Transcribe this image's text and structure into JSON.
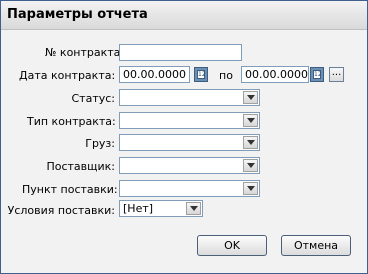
{
  "window": {
    "title": "Параметры отчета"
  },
  "form": {
    "contract_number": {
      "label": "№ контракта:",
      "value": ""
    },
    "contract_date": {
      "label": "Дата контракта:",
      "from": "00.00.0000",
      "separator": "по",
      "to": "00.00.0000",
      "more_button": "..."
    },
    "status": {
      "label": "Статус:",
      "value": ""
    },
    "contract_type": {
      "label": "Тип контракта:",
      "value": ""
    },
    "cargo": {
      "label": "Груз:",
      "value": ""
    },
    "supplier": {
      "label": "Поставщик:",
      "value": ""
    },
    "delivery_point": {
      "label": "Пункт поставки:",
      "value": ""
    },
    "delivery_terms": {
      "label": "Условия поставки:",
      "value": "[Нет]"
    }
  },
  "buttons": {
    "ok": "OK",
    "cancel": "Отмена"
  },
  "icons": {
    "calendar": "calendar-icon",
    "dropdown": "chevron-down-icon"
  },
  "colors": {
    "window_border": "#3f5f8f",
    "background": "#f2f2f2",
    "input_border": "#7f9db9",
    "calendar_button": "#6f8fb1"
  }
}
